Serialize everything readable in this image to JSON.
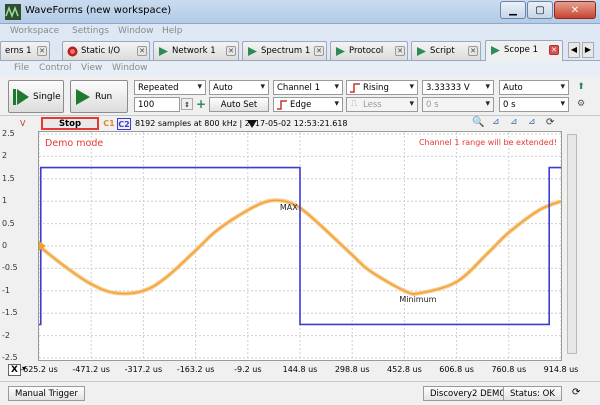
{
  "window": {
    "title": "WaveForms  (new workspace)"
  },
  "menubar": [
    "Workspace",
    "Settings",
    "Window",
    "Help"
  ],
  "tabs": [
    {
      "label": "erns 1",
      "icon": "none"
    },
    {
      "label": "Static I/O",
      "icon": "static-io-icon"
    },
    {
      "label": "Network 1",
      "icon": "network-icon"
    },
    {
      "label": "Spectrum 1",
      "icon": "spectrum-icon"
    },
    {
      "label": "Protocol",
      "icon": "protocol-icon"
    },
    {
      "label": "Script",
      "icon": "script-icon"
    },
    {
      "label": "Scope 1",
      "icon": "scope-icon",
      "active": true
    }
  ],
  "submenu": [
    "File",
    "Control",
    "View",
    "Window"
  ],
  "toolbar": {
    "single_label": "Single",
    "run_label": "Run",
    "mode": "Repeated",
    "trigger_source_mode": "Auto",
    "channel": "Channel 1",
    "edge_type": "Rising",
    "level": "3.33333 V",
    "holdoff_mode": "Auto",
    "count": "100",
    "auto_set_label": "Auto Set",
    "trigger_type": "Edge",
    "condition": "Less",
    "time1": "0 s",
    "time2": "0 s"
  },
  "strip": {
    "axis_unit": "V",
    "stop_label": "Stop",
    "c1_label": "C1",
    "c2_label": "C2",
    "info": "8192 samples at 800 kHz  |  2017-05-02 12:53:21.618"
  },
  "plot": {
    "demo_text": "Demo mode",
    "warning_text": "Channel 1 range will be extended!",
    "max_label": "MAX",
    "min_label": "Minimum",
    "y_ticks": [
      "2.5",
      "2",
      "1.5",
      "1",
      "0.5",
      "0",
      "-0.5",
      "-1",
      "-1.5",
      "-2",
      "-2.5"
    ],
    "x_ticks": [
      "-625.2 us",
      "-471.2 us",
      "-317.2 us",
      "-163.2 us",
      "-9.2 us",
      "144.8 us",
      "298.8 us",
      "452.8 us",
      "606.8 us",
      "760.8 us",
      "914.8 us"
    ]
  },
  "chart_data": {
    "type": "line",
    "xlabel": "",
    "ylabel": "V",
    "xlim": [
      -625.2,
      914.8
    ],
    "ylim": [
      -2.5,
      2.5
    ],
    "grid": true,
    "series": [
      {
        "color": "#f0a030",
        "x": [
          -625.2,
          -550,
          -471.2,
          -400,
          -317.2,
          -250,
          -163.2,
          -100,
          -9.2,
          50,
          100,
          144.8,
          200,
          298.8,
          350,
          452.8,
          500,
          606.8,
          700,
          760.8,
          850,
          914.8
        ],
        "y": [
          0.0,
          -0.45,
          -0.85,
          -1.05,
          -1.0,
          -0.7,
          -0.1,
          0.35,
          0.8,
          1.0,
          1.0,
          0.85,
          0.5,
          -0.2,
          -0.55,
          -1.0,
          -1.05,
          -0.8,
          -0.15,
          0.3,
          0.8,
          1.0
        ]
      },
      {
        "color": "#3b3bd6",
        "x": [
          -625.2,
          -620,
          -620,
          144.8,
          144.8,
          880,
          880,
          914.8
        ],
        "y": [
          -1.75,
          -1.75,
          1.75,
          1.75,
          -1.75,
          -1.75,
          1.75,
          1.75
        ]
      }
    ],
    "annotations": [
      {
        "text": "MAX",
        "x": 100,
        "y": 0.8
      },
      {
        "text": "Minimum",
        "x": 452.8,
        "y": -1.25
      }
    ]
  },
  "bottom": {
    "manual_trigger_label": "Manual Trigger",
    "device_label": "Discovery2 DEMO",
    "status_label": "Status: OK"
  },
  "colors": {
    "ch1": "#f0a030",
    "ch2": "#3b3bd6",
    "stop_border": "#e53935",
    "warning": "#e53935"
  }
}
